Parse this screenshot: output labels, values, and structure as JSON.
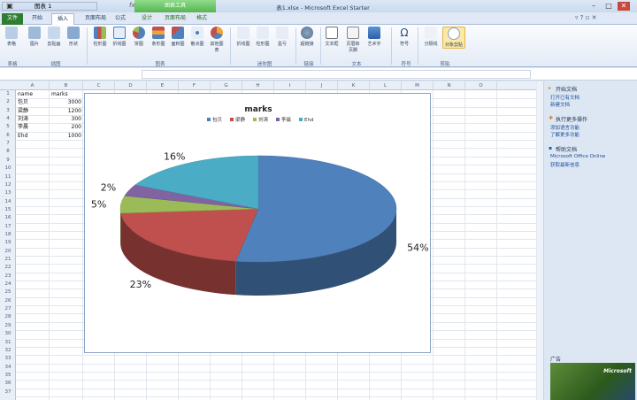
{
  "window": {
    "title": "表1.xlsx - Microsoft Excel Starter",
    "context_group": "图表工具"
  },
  "tabs": [
    {
      "label": "文件"
    },
    {
      "label": "开始"
    },
    {
      "label": "插入"
    },
    {
      "label": "页面布局"
    },
    {
      "label": "公式"
    },
    {
      "label": "设计"
    },
    {
      "label": "页面布局"
    },
    {
      "label": "格式"
    }
  ],
  "ribbon": {
    "buttons": [
      "表格",
      "图片",
      "剪贴画",
      "形状",
      "柱形图",
      "折线图",
      "饼图",
      "条形图",
      "面积图",
      "散点图",
      "其他图表",
      "折线图",
      "柱形图",
      "盈亏",
      "超链接",
      "文本框",
      "页眉和页脚",
      "艺术字",
      "符号",
      "分隔线",
      "对象剪贴"
    ],
    "groups": [
      "表格",
      "插图",
      "图表",
      "迷你图",
      "链接",
      "文本",
      "符号",
      "剪贴"
    ]
  },
  "formula_bar": {
    "name_box": "图表 1",
    "fx": "fx",
    "content": ""
  },
  "columns": [
    "A",
    "B",
    "C",
    "D",
    "E",
    "F",
    "G",
    "H",
    "I",
    "J",
    "K",
    "L",
    "M",
    "N",
    "O"
  ],
  "rows": [
    "1",
    "2",
    "3",
    "4",
    "5",
    "6",
    "7",
    "8",
    "9",
    "10",
    "11",
    "12",
    "13",
    "14",
    "15",
    "16",
    "17",
    "18",
    "19",
    "20",
    "21",
    "22",
    "23",
    "24",
    "25",
    "26",
    "27",
    "28",
    "29",
    "30",
    "31",
    "32",
    "33",
    "34",
    "35",
    "36",
    "37"
  ],
  "cells": {
    "header": {
      "a": "name",
      "b": "marks"
    },
    "data": [
      {
        "a": "包贝",
        "b": "3000"
      },
      {
        "a": "梁静",
        "b": "1200"
      },
      {
        "a": "刘涛",
        "b": "300"
      },
      {
        "a": "李晨",
        "b": "200"
      },
      {
        "a": "Ehd",
        "b": "1000"
      }
    ]
  },
  "chart_data": {
    "type": "pie",
    "title": "marks",
    "categories": [
      "包贝",
      "梁静",
      "刘涛",
      "李晨",
      "Ehd"
    ],
    "values": [
      3000,
      1200,
      300,
      200,
      1000
    ],
    "data_labels": [
      "54%",
      "23%",
      "5%",
      "2%",
      "16%"
    ],
    "colors": [
      "#4f81bd",
      "#c0504d",
      "#9bbb59",
      "#8064a2",
      "#4bacc6"
    ],
    "legend_position": "top",
    "style": "3d"
  },
  "pane": {
    "sections": [
      {
        "title": "开始文档",
        "links": [
          "打开已有文档",
          "新建文档"
        ]
      },
      {
        "title": "执行更多操作",
        "links": [
          "添加语言功能",
          "了解更多功能"
        ]
      },
      {
        "title": "帮助文档",
        "links": [
          "Microsoft Office Online",
          "获取最新信息"
        ]
      }
    ],
    "ad_label": "广告",
    "ad_logo": "Microsoft"
  }
}
